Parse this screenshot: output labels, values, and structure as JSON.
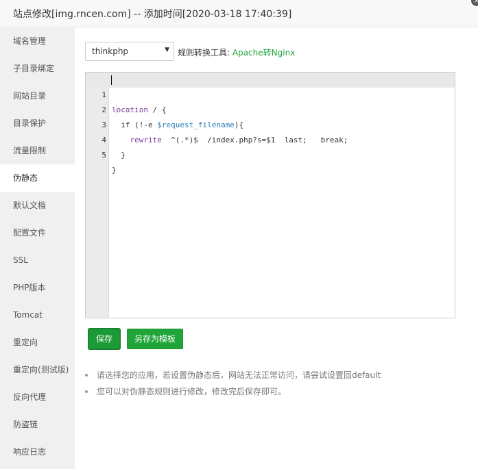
{
  "dialog": {
    "title": "站点修改[img.rncen.com] -- 添加时间[2020-03-18 17:40:39]",
    "close_symbol": "×"
  },
  "sidebar": {
    "active_index": 5,
    "items": [
      {
        "label": "域名管理"
      },
      {
        "label": "子目录绑定"
      },
      {
        "label": "网站目录"
      },
      {
        "label": "目录保护"
      },
      {
        "label": "流量限制"
      },
      {
        "label": "伪静态"
      },
      {
        "label": "默认文档"
      },
      {
        "label": "配置文件"
      },
      {
        "label": "SSL"
      },
      {
        "label": "PHP版本"
      },
      {
        "label": "Tomcat"
      },
      {
        "label": "重定向"
      },
      {
        "label": "重定向(测试版)"
      },
      {
        "label": "反向代理"
      },
      {
        "label": "防盗链"
      },
      {
        "label": "响应日志"
      }
    ]
  },
  "rewrite": {
    "template_select": {
      "value": "thinkphp"
    },
    "converter_label": "规则转换工具:",
    "converter_link": "Apache转Nginx",
    "editor_lines": [
      {
        "num": "1",
        "code": "location / {"
      },
      {
        "num": "2",
        "code": "  if (!-e $request_filename){"
      },
      {
        "num": "3",
        "code": "    rewrite  ^(.*)$  /index.php?s=$1  last;   break;"
      },
      {
        "num": "4",
        "code": "  }"
      },
      {
        "num": "5",
        "code": "}"
      }
    ],
    "save_label": "保存",
    "save_as_template_label": "另存为模板",
    "tips": [
      "请选择您的应用，若设置伪静态后，网站无法正常访问，请尝试设置回default",
      "您可以对伪静态规则进行修改，修改完后保存即可。"
    ]
  },
  "colors": {
    "accent_green": "#20a53a",
    "sidebar_bg": "#f0f0f0",
    "keyword": "#7a3e9d",
    "variable": "#2a7fb8"
  }
}
